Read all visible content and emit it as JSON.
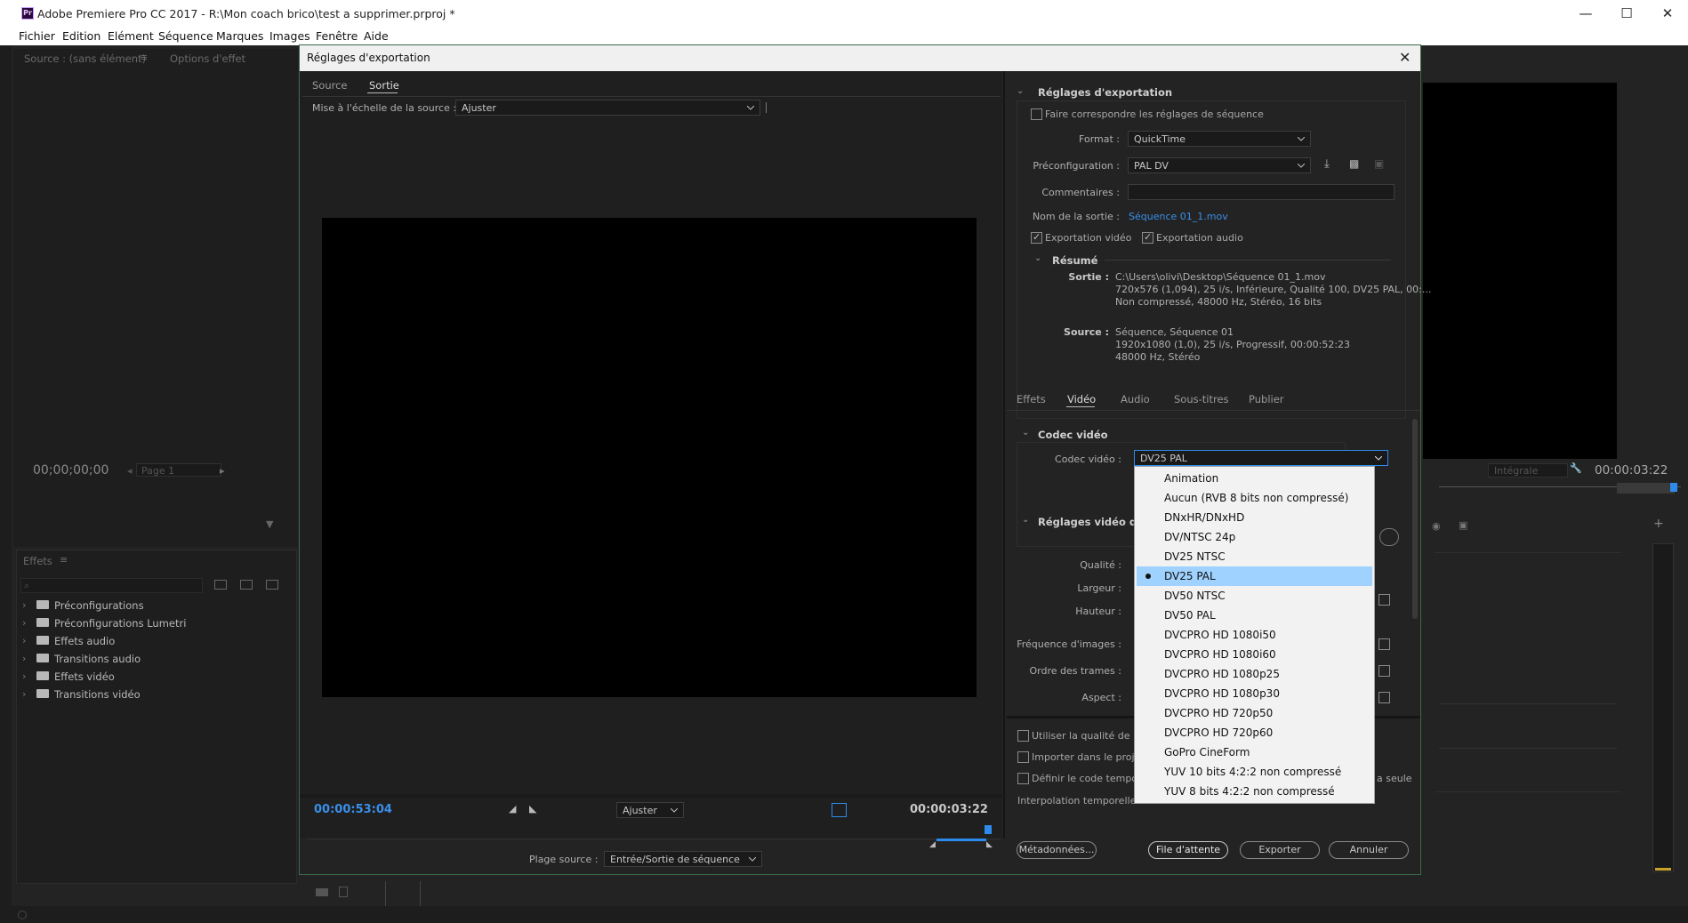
{
  "window": {
    "title": "Adobe Premiere Pro CC 2017 - R:\\Mon coach brico\\test a supprimer.prproj *",
    "app_icon": "Pr"
  },
  "menu": [
    "Fichier",
    "Edition",
    "Elément",
    "Séquence",
    "Marques",
    "Images",
    "Fenêtre",
    "Aide"
  ],
  "left_panels": {
    "source_tab": "Source : (sans élément)",
    "options_tab": "Options d'effet",
    "timecode": "00;00;00;00",
    "page": "Page 1",
    "effects_title": "Effets",
    "effects_items": [
      "Préconfigurations",
      "Préconfigurations Lumetri",
      "Effets audio",
      "Transitions audio",
      "Effets vidéo",
      "Transitions vidéo"
    ]
  },
  "right_monitor": {
    "zoom": "Intégrale",
    "timecode": "00:00:03:22"
  },
  "dialog": {
    "title": "Réglages d'exportation",
    "tabs": [
      "Source",
      "Sortie"
    ],
    "active_tab": "Sortie",
    "scale_label": "Mise à l'échelle de la source :",
    "scale_value": "Ajuster",
    "timecode_left": "00:00:53:04",
    "fit_value": "Ajuster",
    "timecode_right": "00:00:03:22",
    "range_label": "Plage source :",
    "range_value": "Entrée/Sortie de séquence",
    "export_settings": {
      "section_title": "Réglages d'exportation",
      "match_sequence": "Faire correspondre les réglages de séquence",
      "format_label": "Format :",
      "format_value": "QuickTime",
      "preset_label": "Préconfiguration :",
      "preset_value": "PAL DV",
      "comments_label": "Commentaires :",
      "comments_value": "",
      "output_name_label": "Nom de la sortie :",
      "output_name_value": "Séquence 01_1.mov",
      "export_video": "Exportation vidéo",
      "export_audio": "Exportation audio",
      "summary_title": "Résumé",
      "output_label": "Sortie :",
      "output_lines": [
        "C:\\Users\\olivi\\Desktop\\Séquence 01_1.mov",
        "720x576 (1,094), 25 i/s, Inférieure, Qualité  100, DV25 PAL, 00:...",
        "Non compressé, 48000  Hz, Stéréo, 16 bits"
      ],
      "source_label": "Source :",
      "source_lines": [
        "Séquence, Séquence 01",
        "1920x1080 (1,0), 25  i/s, Progressif, 00:00:52:23",
        "48000 Hz, Stéréo"
      ]
    },
    "settings_tabs": [
      "Effets",
      "Vidéo",
      "Audio",
      "Sous-titres",
      "Publier"
    ],
    "active_settings_tab": "Vidéo",
    "codec_section": "Codec vidéo",
    "codec_label": "Codec vidéo :",
    "codec_value": "DV25 PAL",
    "basic_section": "Réglages vidéo de b",
    "field_labels": [
      "Qualité :",
      "Largeur :",
      "Hauteur :",
      "Fréquence d'images :",
      "Ordre des trames :",
      "Aspect :"
    ],
    "bottom_options": [
      "Utiliser la qualité de re",
      "Importer dans le proje",
      "Définir le code tempor"
    ],
    "bottom_suffix": "a seule",
    "interp_label": "Interpolation temporelle",
    "buttons": {
      "metadata": "Métadonnées...",
      "queue": "File d'attente",
      "export": "Exporter",
      "cancel": "Annuler"
    }
  },
  "codec_dropdown": {
    "options": [
      "Animation",
      "Aucun (RVB 8 bits non compressé)",
      "DNxHR/DNxHD",
      "DV/NTSC 24p",
      "DV25 NTSC",
      "DV25 PAL",
      "DV50 NTSC",
      "DV50 PAL",
      "DVCPRO HD 1080i50",
      "DVCPRO HD 1080i60",
      "DVCPRO HD 1080p25",
      "DVCPRO HD 1080p30",
      "DVCPRO HD 720p50",
      "DVCPRO HD 720p60",
      "GoPro CineForm",
      "YUV 10 bits 4:2:2 non compressé",
      "YUV 8 bits 4:2:2 non compressé"
    ],
    "selected": "DV25 PAL"
  },
  "colors": {
    "accent": "#2d8ceb",
    "timecode_blue": "#3a8fe8",
    "highlight": "#9fd2ff"
  }
}
